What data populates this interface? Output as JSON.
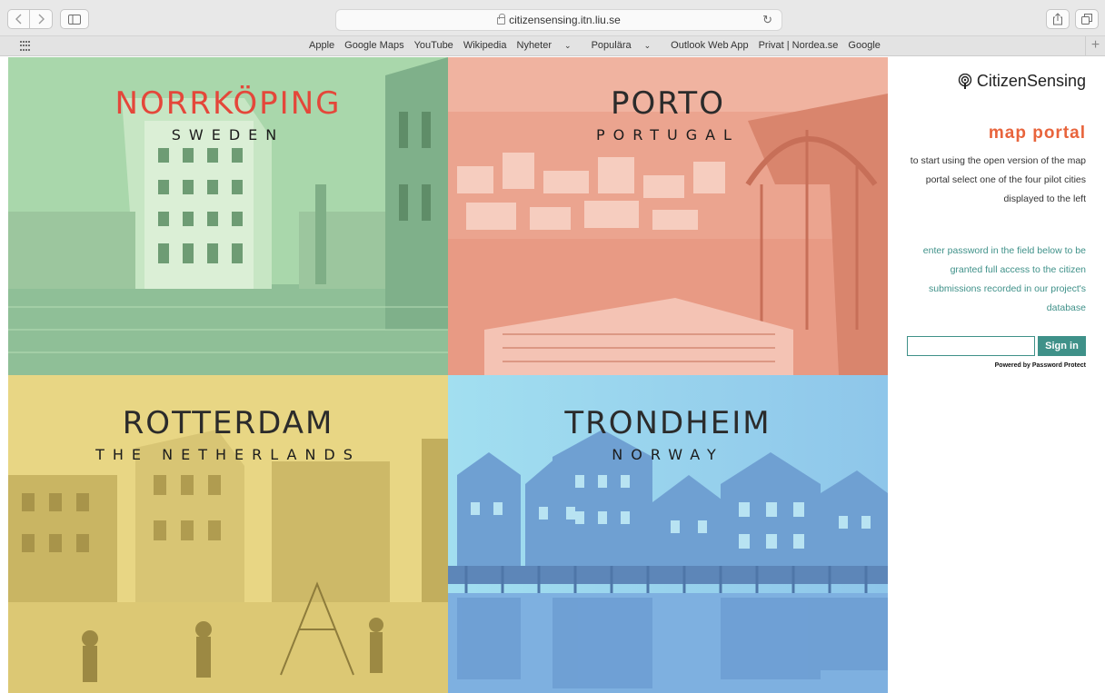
{
  "browser": {
    "url": "citizensensing.itn.liu.se",
    "favorites": [
      {
        "label": "Apple"
      },
      {
        "label": "Google Maps"
      },
      {
        "label": "YouTube"
      },
      {
        "label": "Wikipedia"
      },
      {
        "label": "Nyheter",
        "has_menu": true
      },
      {
        "label": "Populära",
        "has_menu": true
      },
      {
        "label": "Outlook Web App"
      },
      {
        "label": "Privat | Nordea.se"
      },
      {
        "label": "Google"
      }
    ]
  },
  "tiles": [
    {
      "city": "NORRKÖPING",
      "country": "SWEDEN",
      "tint": "#a9d7ab",
      "city_color": "#e4473a"
    },
    {
      "city": "PORTO",
      "country": "PORTUGAL",
      "tint": "#f0b3a0",
      "city_color": "#2b2b2b"
    },
    {
      "city": "ROTTERDAM",
      "country": "THE NETHERLANDS",
      "tint": "#e8d684",
      "city_color": "#2b2b2b"
    },
    {
      "city": "TRONDHEIM",
      "country": "NORWAY",
      "tint": "#8fd0e6",
      "city_color": "#2b2b2b"
    }
  ],
  "panel": {
    "brand": "CitizenSensing",
    "brand_icon": "podcast-icon",
    "title": "map portal",
    "intro": "to start using the open version of the map portal select one of the four pilot cities displayed to the left",
    "password_text": "enter password in the field below to be granted full access to the citizen submissions recorded in our project's database",
    "password_value": "",
    "signin_label": "Sign in",
    "powered_by": "Powered by Password Protect"
  },
  "colors": {
    "accent_orange": "#e8643c",
    "accent_teal": "#3f9189",
    "norrkoping_red": "#e4473a"
  }
}
